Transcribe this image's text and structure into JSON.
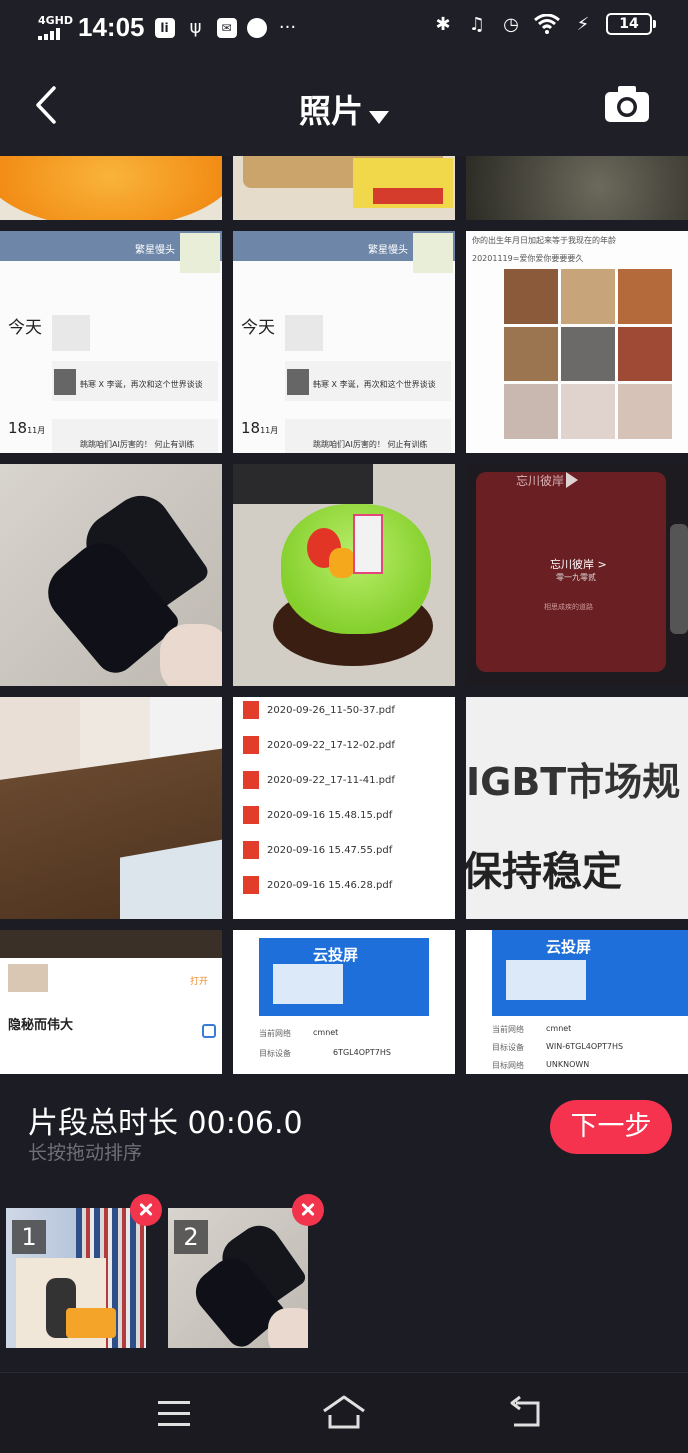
{
  "status_bar": {
    "network": "4GHD",
    "time": "14:05",
    "battery": "14"
  },
  "header": {
    "title": "照片",
    "back_icon": "back-chevron-icon",
    "camera_icon": "camera-icon"
  },
  "grid": {
    "cells": [
      {
        "name": "photo-orange",
        "texts": []
      },
      {
        "name": "photo-food-bag",
        "texts": []
      },
      {
        "name": "photo-dark-surface",
        "texts": []
      },
      {
        "name": "screenshot-chat-1",
        "texts": [
          "繁星慢头",
          "今天",
          "韩寒 X 李诞，再次和这个世界谈谈",
          "18",
          "11月",
          "跳跳咱们AI厉害的！ 何止有训练"
        ]
      },
      {
        "name": "screenshot-chat-2",
        "texts": [
          "繁星慢头",
          "今天",
          "韩寒 X 李诞，再次和这个世界谈谈",
          "18",
          "11月",
          "跳跳咱们AI厉害的！ 何止有训练"
        ]
      },
      {
        "name": "screenshot-collage",
        "texts": [
          "你的出生年月日加起来等于我现在的年龄",
          "20201119=爱你爱你要要要久"
        ]
      },
      {
        "name": "photo-boots",
        "texts": []
      },
      {
        "name": "photo-cake",
        "texts": []
      },
      {
        "name": "screenshot-music",
        "texts": [
          "忘川彼岸",
          "忘川彼岸 >",
          "零一九零贰",
          "相思成疾的道路"
        ]
      },
      {
        "name": "photo-floor",
        "texts": []
      },
      {
        "name": "screenshot-pdf-list",
        "texts": [
          "2020-09-26_11-50-37.pdf",
          "2020-09-22_17-12-02.pdf",
          "2020-09-22_17-11-41.pdf",
          "2020-09-16 15.48.15.pdf",
          "2020-09-16 15.47.55.pdf",
          "2020-09-16 15.46.28.pdf"
        ]
      },
      {
        "name": "photo-document-text",
        "texts": [
          "IGBT市场规",
          "保持稳定"
        ]
      },
      {
        "name": "screenshot-video-app",
        "texts": [
          "隐秘而伟大",
          "打开"
        ]
      },
      {
        "name": "screenshot-cloud-cast-1",
        "texts": [
          "云投屏",
          "当前网络",
          "cmnet",
          "目标设备",
          "6TGL4OPT7HS"
        ]
      },
      {
        "name": "screenshot-cloud-cast-2",
        "texts": [
          "云投屏",
          "当前网络",
          "cmnet",
          "目标设备",
          "WIN-6TGL4OPT7HS",
          "目标网络",
          "UNKNOWN"
        ]
      }
    ]
  },
  "panel": {
    "duration_label": "片段总时长 00:06.0",
    "hint": "长按拖动排序",
    "next_label": "下一步",
    "clips": [
      {
        "index": "1"
      },
      {
        "index": "2"
      }
    ]
  },
  "navbar": {
    "menu_icon": "menu-icon",
    "home_icon": "home-icon",
    "back_icon": "back-icon"
  },
  "colors": {
    "background": "#1c1c24",
    "accent": "#f6334f"
  }
}
